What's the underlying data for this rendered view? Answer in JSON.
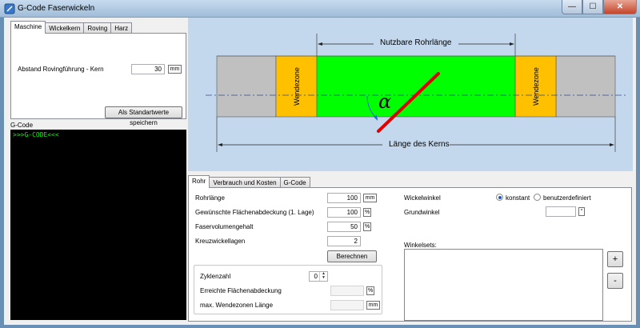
{
  "window": {
    "title": "G-Code Faserwickeln",
    "min_glyph": "—",
    "max_glyph": "☐",
    "close_glyph": "✕"
  },
  "settings_tabs": [
    "Maschine",
    "Wickelkern",
    "Roving",
    "Harz"
  ],
  "machine": {
    "distance_label": "Abstand Rovingführung - Kern",
    "distance_value": "30",
    "distance_unit": "mm",
    "save_defaults_button": "Als Standartwerte speichern"
  },
  "gcode": {
    "label": "G-Code",
    "content": ">>>G-CODE<<<"
  },
  "diagram": {
    "usable_length_label": "Nutzbare Rohrlänge",
    "core_length_label": "Länge des Kerns",
    "turn_zone_left": "Wendezone",
    "turn_zone_right": "Wendezone",
    "angle_symbol": "α",
    "colors": {
      "core": "#c0c0c0",
      "turn_zone": "#ffc000",
      "usable": "#00ff00",
      "fiber": "#e00000",
      "angle_arc": "#1f6fd0"
    }
  },
  "bottom_tabs": [
    "Rohr",
    "Verbrauch und Kosten",
    "G-Code"
  ],
  "pipe": {
    "length_label": "Rohrlänge",
    "length_value": "100",
    "length_unit": "mm",
    "coverage_label": "Gewünschte Flächenabdeckung (1. Lage)",
    "coverage_value": "100",
    "coverage_unit": "%",
    "fiber_volume_label": "Faservolumengehalt",
    "fiber_volume_value": "50",
    "fiber_volume_unit": "%",
    "cross_layers_label": "Kreuzwickellagen",
    "cross_layers_value": "2",
    "calculate_button": "Berechnen",
    "cycles_label": "Zyklenzahl",
    "cycles_value": "0",
    "achieved_coverage_label": "Erreichte Flächenabdeckung",
    "achieved_coverage_unit": "%",
    "max_turn_zone_label": "max. Wendezonen Länge",
    "max_turn_zone_unit": "mm"
  },
  "winding": {
    "angle_label": "Wickelwinkel",
    "option_constant": "konstant",
    "option_custom": "benutzerdefiniert",
    "base_angle_label": "Grundwinkel",
    "base_angle_unit": "°",
    "winding_sets_label": "Winkelsets:",
    "add_button": "+",
    "remove_button": "-"
  }
}
